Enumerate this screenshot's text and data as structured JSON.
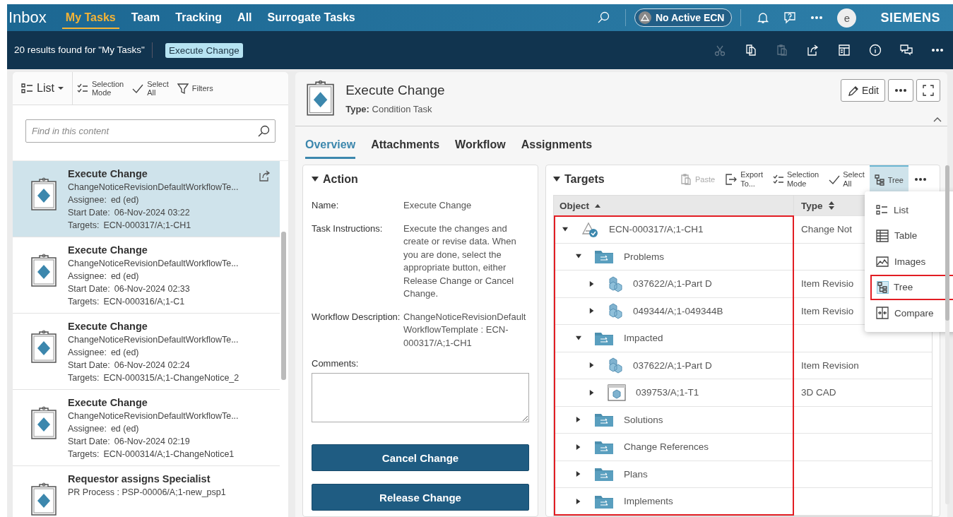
{
  "header": {
    "app_title": "Inbox",
    "tabs": [
      {
        "label": "My Tasks",
        "selected": true
      },
      {
        "label": "Team",
        "selected": false
      },
      {
        "label": "Tracking",
        "selected": false
      },
      {
        "label": "All",
        "selected": false
      },
      {
        "label": "Surrogate Tasks",
        "selected": false
      }
    ],
    "ecn": "No Active ECN",
    "avatar": "e",
    "brand": "SIEMENS"
  },
  "results_bar": {
    "summary": "20 results found for \"My Tasks\"",
    "chip": "Execute Change",
    "tools": [
      {
        "disabled": true
      },
      {
        "disabled": false
      },
      {
        "disabled": true
      },
      {
        "disabled": false
      },
      {
        "disabled": false
      },
      {
        "disabled": false
      },
      {
        "disabled": false
      },
      {
        "disabled": false
      }
    ]
  },
  "task_list": {
    "view": "List",
    "tools": [
      "Selection Mode",
      "Select All",
      "Filters"
    ],
    "search": {
      "placeholder": "Find in this content"
    },
    "tasks": [
      {
        "title": "Execute Change",
        "subtitle": "ChangeNoticeRevisionDefaultWorkflowTe...",
        "selected": true,
        "fields": [
          {
            "label": "Assignee:",
            "value": "ed (ed)"
          },
          {
            "label": "Start Date:",
            "value": "06-Nov-2024 03:22"
          },
          {
            "label": "Targets:",
            "value": "ECN-000317/A;1-CH1"
          }
        ]
      },
      {
        "title": "Execute Change",
        "subtitle": "ChangeNoticeRevisionDefaultWorkflowTe...",
        "selected": false,
        "fields": [
          {
            "label": "Assignee:",
            "value": "ed (ed)"
          },
          {
            "label": "Start Date:",
            "value": "06-Nov-2024 02:33"
          },
          {
            "label": "Targets:",
            "value": "ECN-000316/A;1-C1"
          }
        ]
      },
      {
        "title": "Execute Change",
        "subtitle": "ChangeNoticeRevisionDefaultWorkflowTe...",
        "selected": false,
        "fields": [
          {
            "label": "Assignee:",
            "value": "ed (ed)"
          },
          {
            "label": "Start Date:",
            "value": "06-Nov-2024 02:24"
          },
          {
            "label": "Targets:",
            "value": "ECN-000315/A;1-ChangeNotice_2"
          }
        ]
      },
      {
        "title": "Execute Change",
        "subtitle": "ChangeNoticeRevisionDefaultWorkflowTe...",
        "selected": false,
        "fields": [
          {
            "label": "Assignee:",
            "value": "ed (ed)"
          },
          {
            "label": "Start Date:",
            "value": "06-Nov-2024 02:19"
          },
          {
            "label": "Targets:",
            "value": "ECN-000314/A;1-ChangeNotice1"
          }
        ]
      },
      {
        "title": "Requestor assigns Specialist",
        "subtitle": "PR Process : PSP-00006/A;1-new_psp1",
        "selected": false
      }
    ]
  },
  "detail": {
    "title": "Execute Change",
    "type_label": "Type:",
    "type_value": "Condition Task",
    "edit": "Edit",
    "tabs": [
      {
        "label": "Overview",
        "selected": true
      },
      {
        "label": "Attachments",
        "selected": false
      },
      {
        "label": "Workflow",
        "selected": false
      },
      {
        "label": "Assignments",
        "selected": false
      }
    ],
    "action": {
      "heading": "Action",
      "expanded": true,
      "fields": [
        {
          "label": "Name:",
          "value": "Execute Change"
        },
        {
          "label": "Task Instructions:",
          "value": "Execute the changes and create or revise data. When you are done, select the appropriate button, either Release Change or Cancel Change."
        },
        {
          "label": "Workflow Description:",
          "value": "ChangeNoticeRevisionDefault WorkflowTemplate : ECN-000317/A;1-CH1"
        }
      ],
      "comments_label": "Comments:",
      "buttons": [
        "Cancel Change",
        "Release Change"
      ]
    },
    "targets": {
      "heading": "Targets",
      "expanded": true,
      "tools": [
        {
          "label": "Paste",
          "disabled": true,
          "selected": false
        },
        {
          "label": "Export To...",
          "disabled": false,
          "selected": false
        },
        {
          "label": "Selection Mode",
          "disabled": false,
          "selected": false
        },
        {
          "label": "Select All",
          "disabled": false,
          "selected": false
        },
        {
          "label": "Tree",
          "disabled": false,
          "selected": true
        }
      ],
      "columns": [
        {
          "label": "Object",
          "sorted": true
        },
        {
          "label": "Type",
          "sorted": false
        }
      ],
      "highlighted": true,
      "rows": [
        {
          "kind": "change",
          "name": "ECN-000317/A;1-CH1",
          "type": "Change Not",
          "expanded": true,
          "children": [
            {
              "kind": "folder",
              "name": "Problems",
              "expanded": true,
              "children": [
                {
                  "kind": "part",
                  "name": "037622/A;1-Part D",
                  "type": "Item Revisio",
                  "expanded": false
                },
                {
                  "kind": "part",
                  "name": "049344/A;1-049344B",
                  "type": "Item Revisio",
                  "expanded": false
                }
              ]
            },
            {
              "kind": "folder",
              "name": "Impacted",
              "expanded": true,
              "children": [
                {
                  "kind": "part",
                  "name": "037622/A;1-Part D",
                  "type": "Item Revision",
                  "expanded": false
                },
                {
                  "kind": "cad",
                  "name": "039753/A;1-T1",
                  "type": "3D CAD",
                  "expanded": false
                }
              ]
            },
            {
              "kind": "folder",
              "name": "Solutions",
              "expanded": false
            },
            {
              "kind": "folder",
              "name": "Change References",
              "expanded": false
            },
            {
              "kind": "folder",
              "name": "Plans",
              "expanded": false
            },
            {
              "kind": "folder",
              "name": "Implements",
              "expanded": false
            }
          ]
        }
      ],
      "view_menu": [
        {
          "label": "List",
          "selected": false,
          "highlighted": false
        },
        {
          "label": "Table",
          "selected": false,
          "highlighted": false
        },
        {
          "label": "Images",
          "selected": false,
          "highlighted": false
        },
        {
          "label": "Tree",
          "selected": true,
          "highlighted": true
        },
        {
          "label": "Compare",
          "selected": false,
          "highlighted": false
        }
      ]
    }
  }
}
